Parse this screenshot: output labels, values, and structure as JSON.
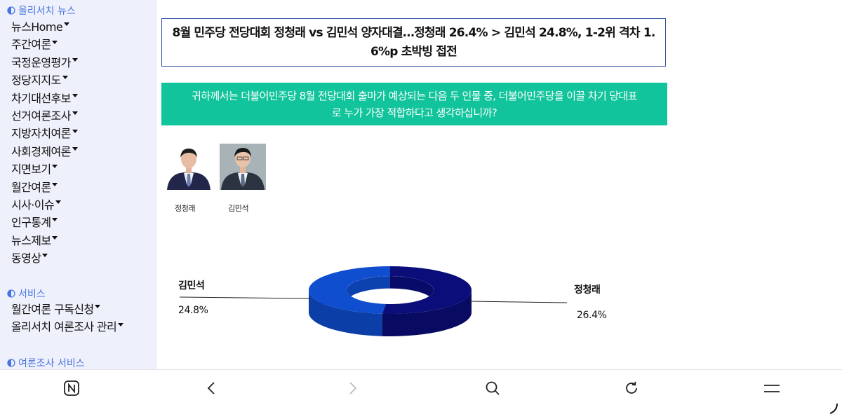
{
  "sidebar": {
    "section1_title": "올리서치 뉴스",
    "nav_items": [
      {
        "label": "뉴스Home"
      },
      {
        "label": "주간여론"
      },
      {
        "label": "국정운영평가"
      },
      {
        "label": "정당지지도"
      },
      {
        "label": "차기대선후보"
      },
      {
        "label": "선거여론조사"
      },
      {
        "label": "지방자치여론"
      },
      {
        "label": "사회경제여론"
      },
      {
        "label": "지면보기"
      },
      {
        "label": "월간여론"
      },
      {
        "label": "시사·이슈"
      },
      {
        "label": "인구통계"
      },
      {
        "label": "뉴스제보"
      },
      {
        "label": "동영상"
      }
    ],
    "section2_title": "서비스",
    "service_items": [
      {
        "label": "월간여론 구독신청"
      },
      {
        "label": "올리서치 여론조사 관리"
      }
    ],
    "section3_title": "여론조사 서비스"
  },
  "article": {
    "headline_line1": "8월 민주당 전당대회 정청래 vs 김민석 양자대결…정청래 26.4% > 김민석 24.8%, 1-2위 격차 1.",
    "headline_line2": "6%p 초박빙 접전",
    "question_line1": "귀하께서는 더불어민주당 8월 전당대회 출마가 예상되는 다음 두 인물 중, 더불어민주당을 이끌 차기 당대표",
    "question_line2": "로 누가 가장 적합하다고 생각하십니까?"
  },
  "candidates": [
    {
      "name": "정청래"
    },
    {
      "name": "김민석"
    }
  ],
  "chart_data": {
    "type": "pie",
    "style": "3d-donut",
    "slices": [
      {
        "name": "정청래",
        "value": 26.4,
        "value_label": "26.4%",
        "color": "#0b0d7a"
      },
      {
        "name": "김민석",
        "value": 24.8,
        "value_label": "24.8%",
        "color": "#0e4ecf"
      }
    ]
  },
  "bottom_nav": {
    "icons": [
      "naver-home-icon",
      "back-icon",
      "forward-icon",
      "search-icon",
      "refresh-icon",
      "menu-icon"
    ]
  }
}
